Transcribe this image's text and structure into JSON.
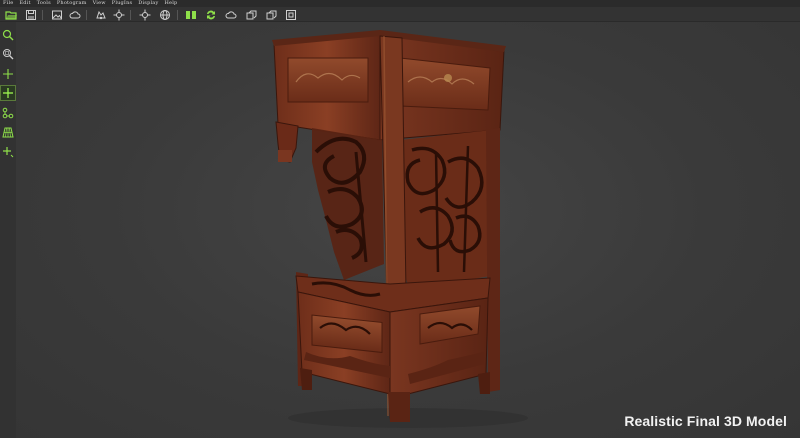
{
  "menu": {
    "items": [
      "File",
      "Edit",
      "Tools",
      "Photogram",
      "View",
      "PlugIns",
      "Display",
      "Help"
    ]
  },
  "toolbar": {
    "icons": [
      "open-folder-icon",
      "save-icon",
      "import-image-icon",
      "cloud-icon",
      "capture-icon",
      "target-icon",
      "globe-icon",
      "pair-green-icon",
      "sync-green-icon",
      "mesh-cloud-icon",
      "transform-icon",
      "transform-alt-icon",
      "snapshot-icon"
    ]
  },
  "side_toolbar": {
    "icons": [
      "zoom-icon",
      "zoom-region-icon",
      "crosshair-icon",
      "crosshair-active-icon",
      "link-nodes-icon",
      "perspective-grid-icon",
      "move-icon"
    ]
  },
  "viewport": {
    "caption": "Realistic Final 3D Model",
    "background_color": "#3a3a3a",
    "model_wood_color": "#7a3a22"
  },
  "colors": {
    "menu_bg": "#2b2b2b",
    "toolbar_bg": "#333333",
    "icon_green": "#8fe04a",
    "icon_gray": "#cfcfcf"
  }
}
